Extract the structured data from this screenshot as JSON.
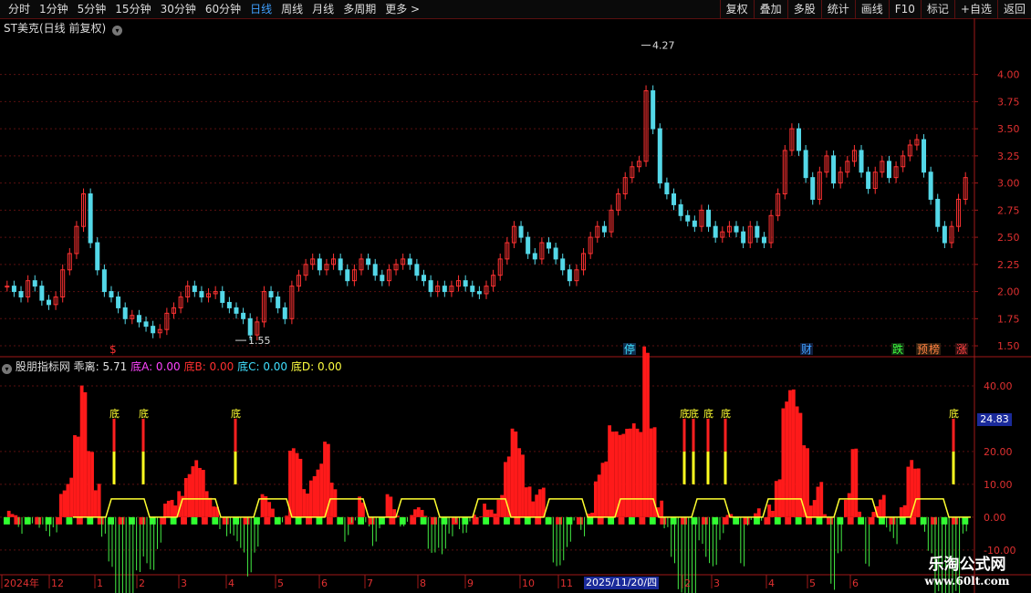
{
  "toolbar": {
    "periods": [
      "分时",
      "1分钟",
      "5分钟",
      "15分钟",
      "30分钟",
      "60分钟",
      "日线",
      "周线",
      "月线",
      "多周期",
      "更多 >"
    ],
    "active_period": "日线",
    "tools": [
      "复权",
      "叠加",
      "多股",
      "统计",
      "画线",
      "F10",
      "标记",
      "+自选",
      "返回"
    ]
  },
  "main_title": "ST美克(日线 前复权)",
  "indicator": {
    "name": "股朋指标网",
    "values": [
      {
        "label": "乖离: 5.71",
        "color": "#e0e0e0"
      },
      {
        "label": "底A: 0.00",
        "color": "#ff44ff"
      },
      {
        "label": "底B: 0.00",
        "color": "#ff3030"
      },
      {
        "label": "底C: 0.00",
        "color": "#40e0ff"
      },
      {
        "label": "底D: 0.00",
        "color": "#ffff40"
      }
    ],
    "current_value": "24.83",
    "signal_label": "底"
  },
  "price_axis": [
    "4.00",
    "3.75",
    "3.50",
    "3.25",
    "3.00",
    "2.75",
    "2.50",
    "2.25",
    "2.00",
    "1.75",
    "1.50"
  ],
  "ind_axis": [
    "40.00",
    "20.00",
    "10.00",
    "0.00",
    "-10.00"
  ],
  "high_label": "4.27",
  "low_label": "1.55",
  "events": [
    {
      "text": "$",
      "color": "#ff3030",
      "bg": "transparent"
    },
    {
      "text": "停",
      "color": "#40e0ff",
      "bg": "#103050"
    },
    {
      "text": "财",
      "color": "#40a0ff",
      "bg": "#102040"
    },
    {
      "text": "跌",
      "color": "#40ff40",
      "bg": "#103010"
    },
    {
      "text": "预",
      "color": "#ff8040",
      "bg": "#302010"
    },
    {
      "text": "榜",
      "color": "#ff8040",
      "bg": "#302010"
    },
    {
      "text": "涨",
      "color": "#ff4040",
      "bg": "#301010"
    }
  ],
  "x_axis": [
    "2024年",
    "12",
    "1",
    "2",
    "3",
    "4",
    "5",
    "6",
    "7",
    "8",
    "9",
    "10",
    "11",
    "2",
    "3",
    "4",
    "5",
    "6"
  ],
  "cursor_date": "2025/11/20/四",
  "watermark": {
    "line1": "乐淘公式网",
    "line2": "www.60lt.com"
  },
  "chart_data": {
    "type": "candlestick",
    "y_range": [
      1.45,
      4.35
    ],
    "closes": [
      2.05,
      2.0,
      1.95,
      2.1,
      2.05,
      1.92,
      1.88,
      1.95,
      2.2,
      2.35,
      2.6,
      2.9,
      2.45,
      2.2,
      2.0,
      1.95,
      1.85,
      1.75,
      1.78,
      1.72,
      1.68,
      1.62,
      1.65,
      1.8,
      1.85,
      1.95,
      2.05,
      2.0,
      1.95,
      1.98,
      2.0,
      1.9,
      1.85,
      1.8,
      1.75,
      1.6,
      1.72,
      2.0,
      1.95,
      1.85,
      1.75,
      2.05,
      2.15,
      2.25,
      2.3,
      2.2,
      2.25,
      2.3,
      2.2,
      2.1,
      2.2,
      2.3,
      2.25,
      2.15,
      2.1,
      2.2,
      2.25,
      2.3,
      2.25,
      2.15,
      2.1,
      2.0,
      2.05,
      2.0,
      2.05,
      2.1,
      2.05,
      2.0,
      1.98,
      2.05,
      2.15,
      2.3,
      2.45,
      2.6,
      2.5,
      2.35,
      2.3,
      2.45,
      2.4,
      2.3,
      2.2,
      2.1,
      2.2,
      2.35,
      2.5,
      2.6,
      2.55,
      2.75,
      2.9,
      3.05,
      3.15,
      3.2,
      3.85,
      3.5,
      3.0,
      2.9,
      2.8,
      2.7,
      2.65,
      2.6,
      2.75,
      2.6,
      2.5,
      2.55,
      2.6,
      2.55,
      2.45,
      2.6,
      2.5,
      2.45,
      2.7,
      2.9,
      3.3,
      3.5,
      3.3,
      3.05,
      2.85,
      3.1,
      3.25,
      3.0,
      3.1,
      3.2,
      3.3,
      3.1,
      2.95,
      3.1,
      3.2,
      3.05,
      3.15,
      3.25,
      3.35,
      3.4,
      3.1,
      2.85,
      2.6,
      2.45,
      2.6,
      2.85,
      3.05
    ]
  }
}
